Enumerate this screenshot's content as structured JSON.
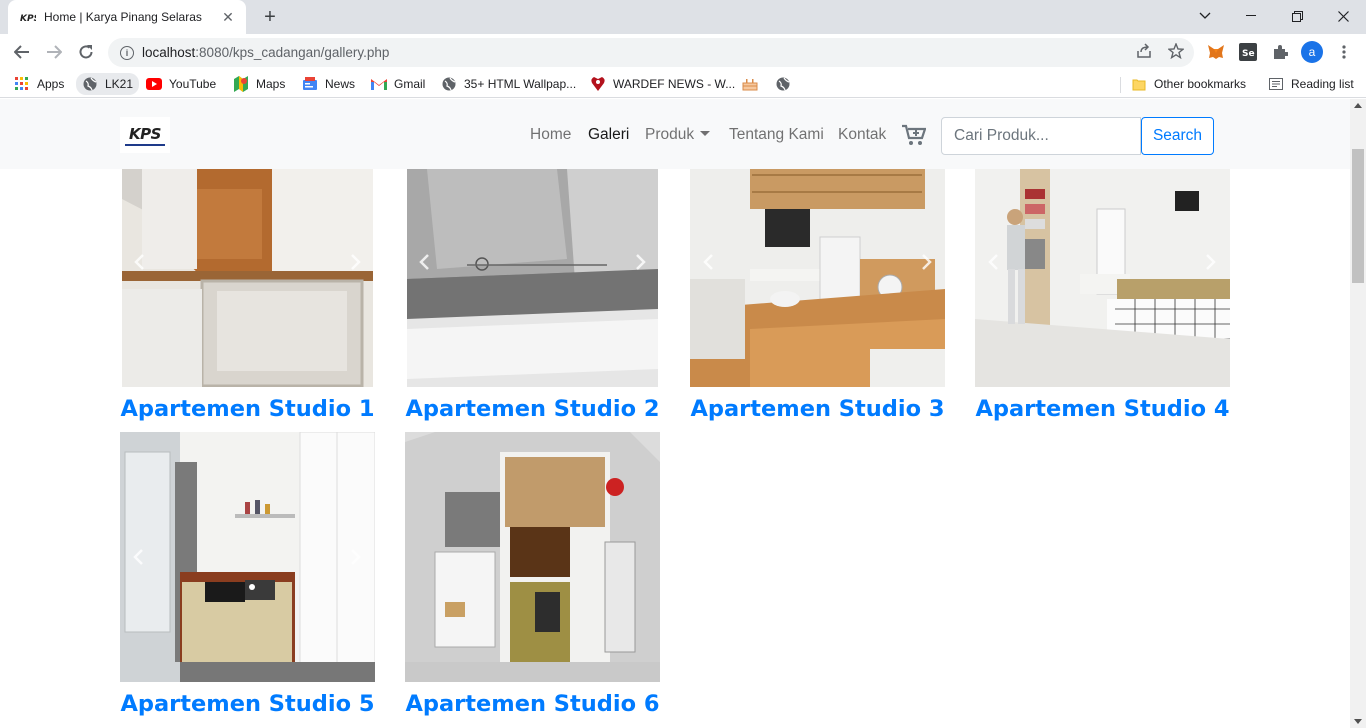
{
  "browser": {
    "tab_title": "Home | Karya Pinang Selaras",
    "url_host": "localhost",
    "url_rest": ":8080/kps_cadangan/gallery.php",
    "new_tab": "+",
    "close": "✕",
    "avatar_letter": "a"
  },
  "bookmarks": [
    {
      "label": "Apps",
      "icon": "apps-grid-icon"
    },
    {
      "label": "LK21",
      "icon": "globe-icon"
    },
    {
      "label": "YouTube",
      "icon": "youtube-icon"
    },
    {
      "label": "Maps",
      "icon": "maps-icon"
    },
    {
      "label": "News",
      "icon": "news-icon"
    },
    {
      "label": "Gmail",
      "icon": "gmail-icon"
    },
    {
      "label": "35+ HTML Wallpap...",
      "icon": "globe-icon"
    },
    {
      "label": "WARDEF NEWS - W...",
      "icon": "wardef-icon"
    },
    {
      "label": "",
      "icon": "cake-icon"
    },
    {
      "label": "",
      "icon": "globe-icon"
    }
  ],
  "bookmarks_right": {
    "other": "Other bookmarks",
    "reading": "Reading list"
  },
  "site": {
    "brand": "KPS",
    "nav": [
      {
        "label": "Home",
        "active": false
      },
      {
        "label": "Galeri",
        "active": true
      },
      {
        "label": "Produk",
        "active": false,
        "dropdown": true
      },
      {
        "label": "Tentang Kami",
        "active": false
      },
      {
        "label": "Kontak",
        "active": false
      }
    ],
    "search_placeholder": "Cari Produk...",
    "search_button": "Search"
  },
  "gallery": [
    {
      "caption": "Apartemen Studio 1"
    },
    {
      "caption": "Apartemen Studio 2"
    },
    {
      "caption": "Apartemen Studio 3"
    },
    {
      "caption": "Apartemen Studio 4"
    },
    {
      "caption": "Apartemen Studio 5"
    },
    {
      "caption": "Apartemen Studio 6"
    }
  ],
  "colors": {
    "link_blue": "#007bff",
    "navbar_bg": "#f8f9fa",
    "chrome_tabstrip": "#dee1e6"
  }
}
